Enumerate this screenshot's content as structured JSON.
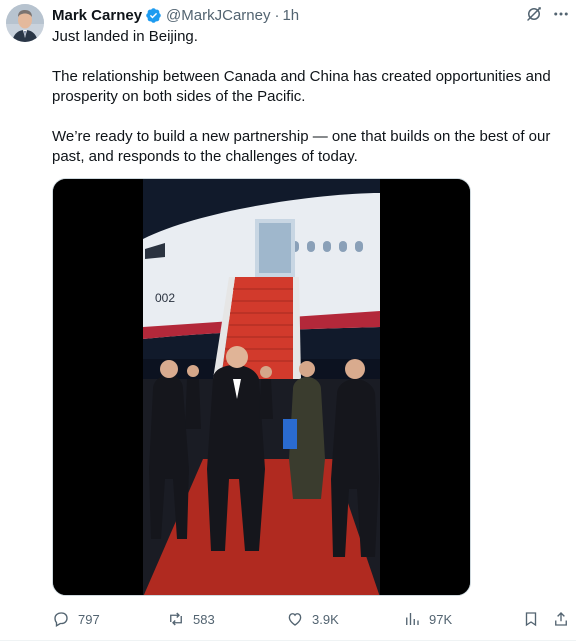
{
  "author": {
    "name": "Mark Carney",
    "handle": "@MarkJCarney",
    "separator": "·",
    "time": "1h",
    "verified_color": "#1d9bf0"
  },
  "tweet": {
    "paragraphs": [
      "Just landed in Beijing.",
      "The relationship between Canada and China has created opportunities and prosperity on both sides of the Pacific.",
      "We’re ready to build a new partnership — one that builds on the best of our past, and responds to the challenges of today."
    ],
    "media_alt_icon": "video-thumbnail"
  },
  "plane": {
    "tail_number": "002"
  },
  "actions": {
    "replies": "797",
    "reposts": "583",
    "likes": "3.9K",
    "views": "97K"
  },
  "colors": {
    "text_primary": "#0f1419",
    "text_secondary": "#536471",
    "accent": "#1d9bf0"
  }
}
